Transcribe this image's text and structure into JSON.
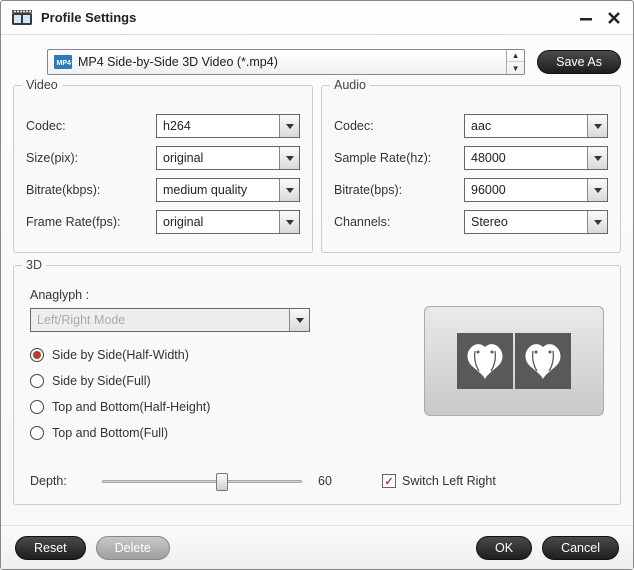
{
  "window": {
    "title": "Profile Settings"
  },
  "toolbar": {
    "profile_value": "MP4 Side-by-Side 3D Video (*.mp4)",
    "save_as_label": "Save As"
  },
  "video": {
    "title": "Video",
    "codec_label": "Codec:",
    "codec_value": "h264",
    "size_label": "Size(pix):",
    "size_value": "original",
    "bitrate_label": "Bitrate(kbps):",
    "bitrate_value": "medium quality",
    "framerate_label": "Frame Rate(fps):",
    "framerate_value": "original"
  },
  "audio": {
    "title": "Audio",
    "codec_label": "Codec:",
    "codec_value": "aac",
    "samplerate_label": "Sample Rate(hz):",
    "samplerate_value": "48000",
    "bitrate_label": "Bitrate(bps):",
    "bitrate_value": "96000",
    "channels_label": "Channels:",
    "channels_value": "Stereo"
  },
  "threeD": {
    "title": "3D",
    "anaglyph_label": "Anaglyph :",
    "mode_value": "Left/Right Mode",
    "radios": {
      "sbs_half": "Side by Side(Half-Width)",
      "sbs_full": "Side by Side(Full)",
      "tb_half": "Top and Bottom(Half-Height)",
      "tb_full": "Top and Bottom(Full)"
    },
    "selected_radio": "sbs_half",
    "depth_label": "Depth:",
    "depth_value": "60",
    "depth_percent": 60,
    "switch_label": "Switch Left Right",
    "switch_checked": true
  },
  "footer": {
    "reset_label": "Reset",
    "delete_label": "Delete",
    "ok_label": "OK",
    "cancel_label": "Cancel"
  }
}
